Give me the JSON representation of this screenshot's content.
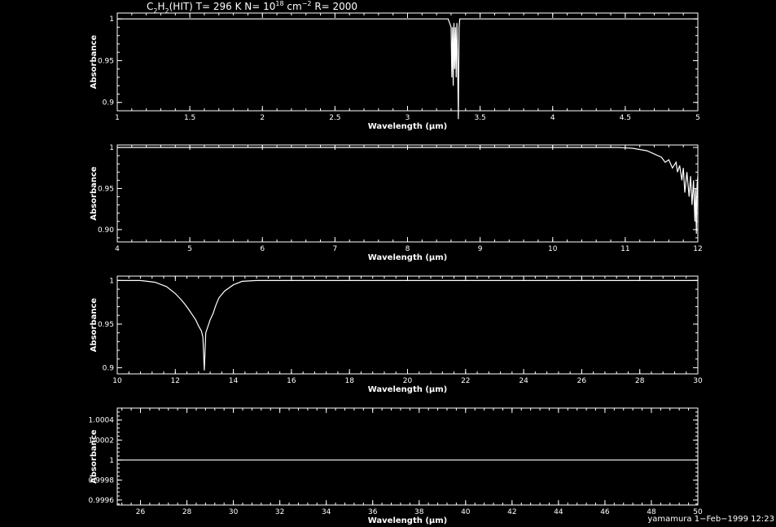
{
  "figure": {
    "title_parts": {
      "c": "C",
      "c_sub": "2",
      "h": "H",
      "h_sub": "2",
      "src": "(HIT) T= 296 K N= 10",
      "n_exp": "18",
      "unit": " cm",
      "unit_exp": "−2",
      "res": " R= 2000"
    },
    "footer": "yamamura  1−Feb−1999 12:23"
  },
  "chart_data": [
    {
      "type": "line",
      "xlabel": "Wavelength (μm)",
      "ylabel": "Absorbance",
      "xlim": [
        1,
        5
      ],
      "ylim": [
        0.89,
        1.007
      ],
      "xticks": [
        1,
        1.5,
        2,
        2.5,
        3,
        3.5,
        4,
        4.5,
        5
      ],
      "xtick_labels": [
        "1",
        "1.5",
        "2",
        "2.5",
        "3",
        "3.5",
        "4",
        "4.5",
        "5"
      ],
      "yticks": [
        0.9,
        0.95,
        1
      ],
      "ytick_labels": [
        "0.9",
        "0.95",
        "1"
      ],
      "series": [
        {
          "x": [
            1.0,
            3.2,
            3.28,
            3.29,
            3.3,
            3.305,
            3.31,
            3.315,
            3.32,
            3.325,
            3.33,
            3.335,
            3.34,
            3.345,
            3.35,
            3.355,
            3.36,
            3.37,
            3.38,
            5.0
          ],
          "y": [
            1.0,
            1.0,
            1.0,
            0.995,
            0.99,
            0.93,
            0.99,
            0.92,
            0.995,
            0.94,
            0.99,
            0.93,
            0.995,
            0.95,
            0.88,
            0.99,
            1.0,
            1.0,
            1.0,
            1.0
          ]
        }
      ]
    },
    {
      "type": "line",
      "xlabel": "Wavelength (μm)",
      "ylabel": "Absorbance",
      "xlim": [
        4,
        12
      ],
      "ylim": [
        0.885,
        1.003
      ],
      "xticks": [
        4,
        5,
        6,
        7,
        8,
        9,
        10,
        11,
        12
      ],
      "xtick_labels": [
        "4",
        "5",
        "6",
        "7",
        "8",
        "9",
        "10",
        "11",
        "12"
      ],
      "yticks": [
        0.9,
        0.95,
        1
      ],
      "ytick_labels": [
        "0.90",
        "0.95",
        "1"
      ],
      "series": [
        {
          "x": [
            4.0,
            10.9,
            11.1,
            11.3,
            11.4,
            11.5,
            11.55,
            11.6,
            11.65,
            11.7,
            11.72,
            11.75,
            11.78,
            11.8,
            11.82,
            11.85,
            11.88,
            11.9,
            11.92,
            11.94,
            11.96,
            11.97,
            11.98,
            11.99,
            12.0
          ],
          "y": [
            1.0,
            1.0,
            0.999,
            0.996,
            0.992,
            0.988,
            0.982,
            0.985,
            0.975,
            0.982,
            0.97,
            0.978,
            0.96,
            0.975,
            0.945,
            0.97,
            0.94,
            0.965,
            0.93,
            0.96,
            0.91,
            0.95,
            0.895,
            0.955,
            0.965
          ]
        }
      ]
    },
    {
      "type": "line",
      "xlabel": "Wavelength (μm)",
      "ylabel": "Absorbance",
      "xlim": [
        10,
        30
      ],
      "ylim": [
        0.893,
        1.005
      ],
      "xticks": [
        10,
        12,
        14,
        16,
        18,
        20,
        22,
        24,
        26,
        28,
        30
      ],
      "xtick_labels": [
        "10",
        "12",
        "14",
        "16",
        "18",
        "20",
        "22",
        "24",
        "26",
        "28",
        "30"
      ],
      "yticks": [
        0.9,
        0.95,
        1
      ],
      "ytick_labels": [
        "0.9",
        "0.95",
        "1"
      ],
      "series": [
        {
          "x": [
            10.0,
            10.8,
            11.3,
            11.7,
            12.0,
            12.2,
            12.35,
            12.5,
            12.6,
            12.7,
            12.8,
            12.9,
            12.95,
            13.0,
            13.05,
            13.1,
            13.2,
            13.3,
            13.4,
            13.5,
            13.7,
            14.0,
            14.3,
            14.8,
            30.0
          ],
          "y": [
            1.0,
            1.0,
            0.998,
            0.993,
            0.985,
            0.978,
            0.972,
            0.965,
            0.96,
            0.955,
            0.948,
            0.942,
            0.935,
            0.897,
            0.94,
            0.945,
            0.955,
            0.962,
            0.972,
            0.98,
            0.988,
            0.995,
            0.999,
            1.0,
            1.0
          ]
        }
      ]
    },
    {
      "type": "line",
      "xlabel": "Wavelength (μm)",
      "ylabel": "Absorbance",
      "xlim": [
        25,
        50
      ],
      "ylim": [
        0.99955,
        1.00052
      ],
      "xticks": [
        26,
        28,
        30,
        32,
        34,
        36,
        38,
        40,
        42,
        44,
        46,
        48,
        50
      ],
      "xtick_labels": [
        "26",
        "28",
        "30",
        "32",
        "34",
        "36",
        "38",
        "40",
        "42",
        "44",
        "46",
        "48",
        "50"
      ],
      "yticks": [
        0.9996,
        0.9998,
        1,
        1.0002,
        1.0004
      ],
      "ytick_labels": [
        "0.9996",
        "0.9998",
        "1",
        "1.0002",
        "1.0004"
      ],
      "series": [
        {
          "x": [
            25,
            50
          ],
          "y": [
            1.0,
            1.0
          ]
        }
      ]
    }
  ]
}
